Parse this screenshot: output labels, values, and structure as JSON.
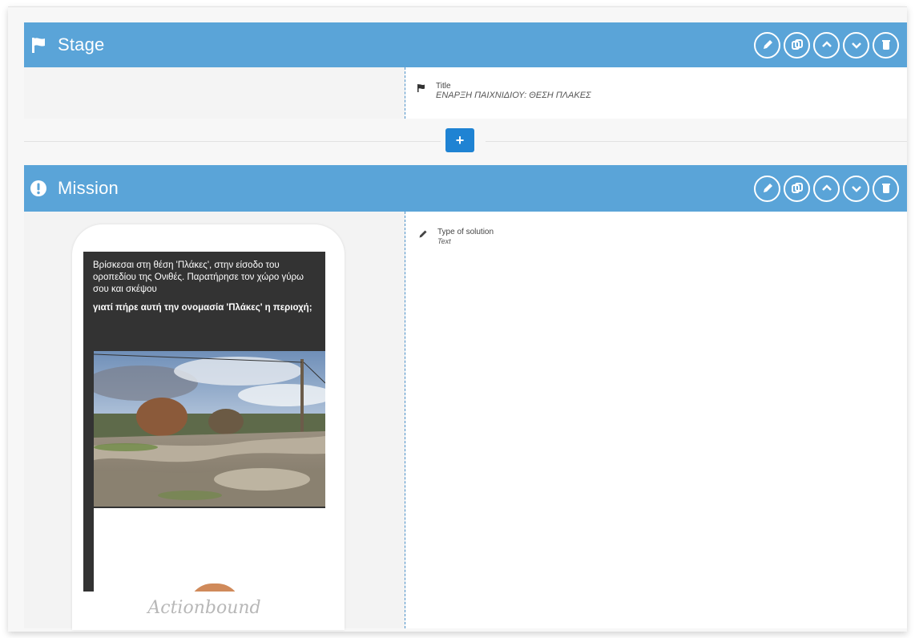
{
  "stage": {
    "title": "Stage",
    "icon": "flag-icon",
    "actions": [
      "edit-icon",
      "duplicate-icon",
      "move-up-icon",
      "move-down-icon",
      "delete-icon"
    ],
    "property": {
      "label": "Title",
      "value": "ΕΝΑΡΞΗ ΠΑΙΧΝΙΔΙΟΥ: ΘΕΣΗ ΠΛΑΚΕΣ",
      "icon": "flag-icon"
    }
  },
  "add_button": {
    "label": "+"
  },
  "mission": {
    "title": "Mission",
    "icon": "exclamation-icon",
    "actions": [
      "edit-icon",
      "duplicate-icon",
      "move-up-icon",
      "move-down-icon",
      "delete-icon"
    ],
    "property": {
      "label": "Type of solution",
      "value": "Text",
      "icon": "pencil-icon"
    },
    "preview": {
      "text": "Βρίσκεσαι στη θέση 'Πλάκες', στην είσοδο του οροπεδίου της Ονιθές. Παρατήρησε τον χώρο γύρω σου και σκέψου",
      "question": "γιατί πήρε αυτή την ονομασία 'Πλάκες' η περιοχή;",
      "brand": "Actionbound"
    }
  },
  "colors": {
    "header_bar": "#5aa4d8",
    "add_button": "#1f83d3",
    "phone_screen": "#333333"
  }
}
